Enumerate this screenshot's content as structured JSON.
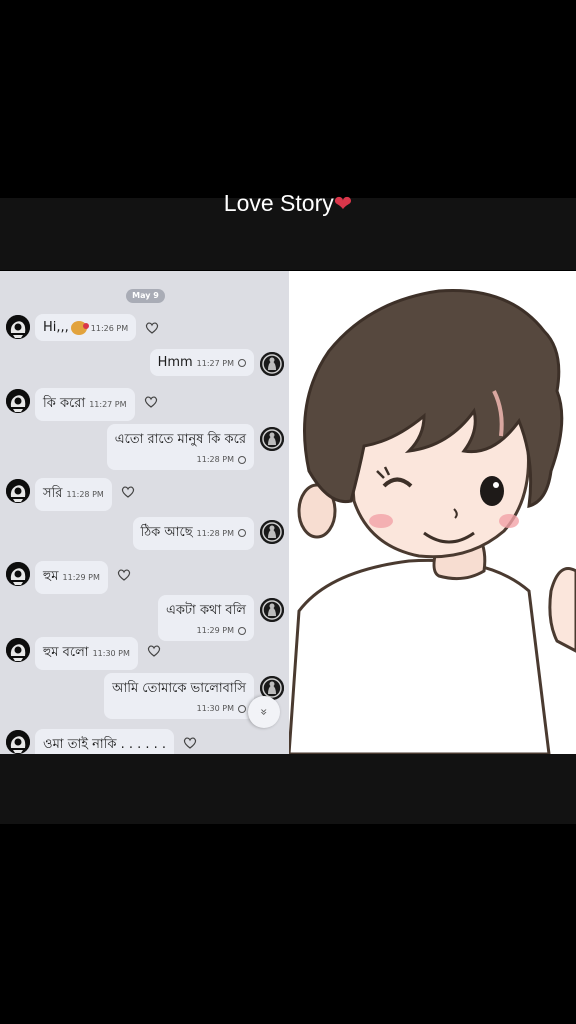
{
  "video": {
    "title": "Love Story",
    "title_emoji_icon": "red-heart-bandage-icon"
  },
  "chat": {
    "date_chip": "May 9",
    "messages": [
      {
        "side": "in",
        "text": "Hi,,,",
        "emoji": "kiss-face-icon",
        "time": "11:26 PM"
      },
      {
        "side": "out",
        "text": "Hmm",
        "time": "11:27 PM"
      },
      {
        "side": "in",
        "text": "কি করো",
        "time": "11:27 PM"
      },
      {
        "side": "out",
        "text": "এতো রাতে মানুষ কি করে",
        "time": "11:28 PM"
      },
      {
        "side": "in",
        "text": "সরি",
        "time": "11:28 PM"
      },
      {
        "side": "out",
        "text": "ঠিক আছে",
        "time": "11:28 PM"
      },
      {
        "side": "in",
        "text": "হুম",
        "time": "11:29 PM"
      },
      {
        "side": "out",
        "text": "একটা কথা বলি",
        "time": "11:29 PM"
      },
      {
        "side": "in",
        "text": "হুম বলো",
        "time": "11:30 PM"
      },
      {
        "side": "out",
        "text": "আমি তোমাকে ভালোবাসি",
        "time": "11:30 PM"
      },
      {
        "side": "in",
        "text": "ওমা তাই নাকি . . . . . ."
      }
    ],
    "scroll_button_icon": "double-chevron-down-icon"
  },
  "picture": {
    "subject": "cartoon-boy-winking-thumbs-up"
  },
  "colors": {
    "background": "#000000",
    "band": "#121212",
    "chat_bg": "#dcdde3",
    "bubble": "#eceef4",
    "heart": "#d9364a"
  }
}
